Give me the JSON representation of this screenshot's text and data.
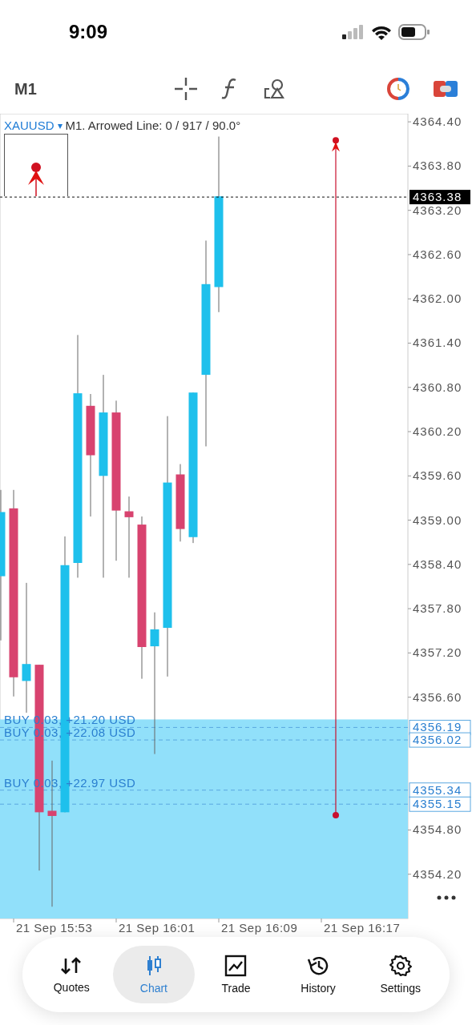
{
  "status_bar": {
    "time": "9:09"
  },
  "toolbar": {
    "timeframe": "M1"
  },
  "chart_header": {
    "symbol": "XAUUSD",
    "symbol_caret": "▾",
    "info": "M1. Arrowed Line: 0 / 917 / 90.0°"
  },
  "chart": {
    "price_axis": [
      "4364.40",
      "4363.80",
      "4363.20",
      "4362.60",
      "4362.00",
      "4361.40",
      "4360.80",
      "4360.20",
      "4359.60",
      "4359.00",
      "4358.40",
      "4357.80",
      "4357.20",
      "4356.60",
      "4354.80",
      "4354.20"
    ],
    "time_axis": [
      "21 Sep 15:53",
      "21 Sep 16:01",
      "21 Sep 16:09",
      "21 Sep 16:17"
    ],
    "current_price": "4363.38",
    "positions": [
      {
        "text": "BUY 0.03, +21.20 USD",
        "price": "4356.19"
      },
      {
        "text": "BUY 0.03, +22.08 USD",
        "price": "4356.02"
      },
      {
        "text": "BUY 0.03, +22.97 USD",
        "price": "4355.34"
      },
      {
        "price": "4355.15"
      }
    ]
  },
  "tabs": [
    {
      "label": "Quotes",
      "selected": false
    },
    {
      "label": "Chart",
      "selected": true
    },
    {
      "label": "Trade",
      "selected": false
    },
    {
      "label": "History",
      "selected": false
    },
    {
      "label": "Settings",
      "selected": false
    }
  ]
}
